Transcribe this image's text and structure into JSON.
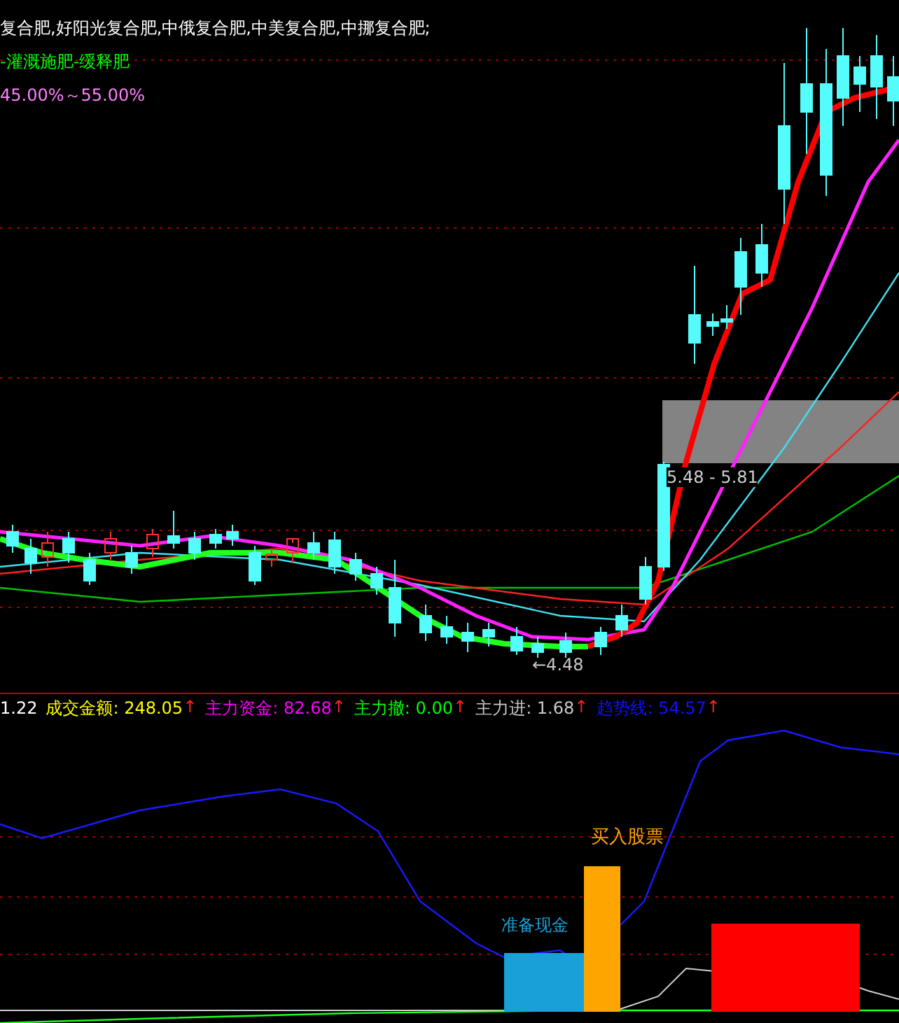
{
  "main_panel": {
    "lines": [
      {
        "text": "复合肥,好阳光复合肥,中俄复合肥,中美复合肥,中挪复合肥;",
        "color": "#ffffff"
      },
      {
        "text": "-灌溉施肥-缓释肥",
        "color": "#00ff00"
      },
      {
        "text": "45.00%～55.00%",
        "color": "#ff80ff"
      }
    ],
    "low_label": "←4.48",
    "zone_label": "5.48 - 5.81"
  },
  "indicator_bar": {
    "lead_value": "1.22",
    "items": [
      {
        "label": "成交金额:",
        "value": "248.05",
        "arrow": "↑",
        "color": "#ffff00"
      },
      {
        "label": "主力资金:",
        "value": "82.68",
        "arrow": "↑",
        "color": "#ff00ff"
      },
      {
        "label": "主力撤:",
        "value": "0.00",
        "arrow": "↑",
        "color": "#00ff00"
      },
      {
        "label": "主力进:",
        "value": "1.68",
        "arrow": "↑",
        "color": "#c8c8c8"
      },
      {
        "label": "趋势线:",
        "value": "54.57",
        "arrow": "↑",
        "color": "#1010ff"
      }
    ]
  },
  "lower_panel": {
    "signals": [
      {
        "label": "准备现金",
        "color": "#1aa0d8"
      },
      {
        "label": "买入股票",
        "color": "#ffa500"
      }
    ]
  }
}
